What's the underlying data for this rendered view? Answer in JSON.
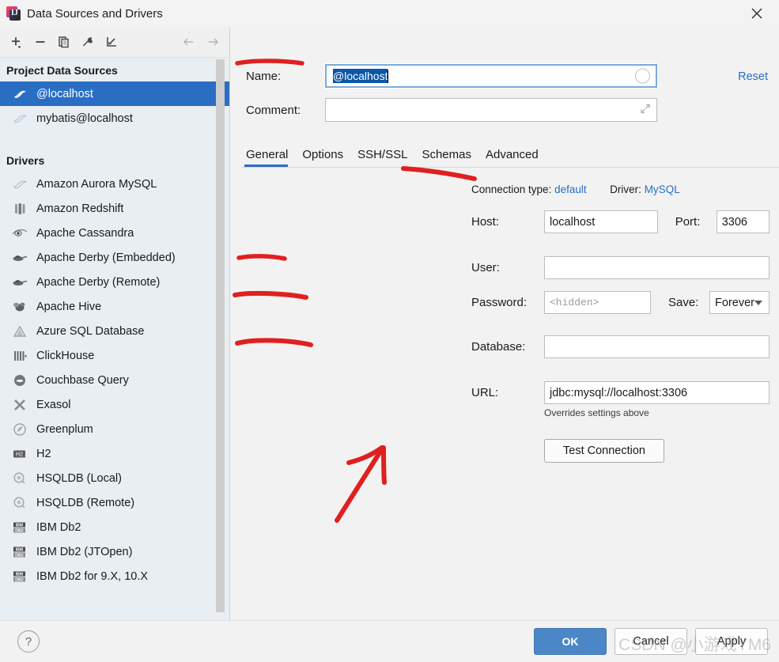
{
  "window": {
    "title": "Data Sources and Drivers",
    "app_icon": "intellij-idea-icon",
    "close_icon": "close-icon"
  },
  "left_panel": {
    "toolbar": [
      {
        "name": "add-button",
        "icon": "plus-icon"
      },
      {
        "name": "remove-button",
        "icon": "minus-icon"
      },
      {
        "name": "copy-button",
        "icon": "copy-icon"
      },
      {
        "name": "properties-button",
        "icon": "wrench-icon"
      },
      {
        "name": "import-button",
        "icon": "import-arrow-icon"
      },
      {
        "name": "back-button",
        "icon": "arrow-left-icon"
      },
      {
        "name": "forward-button",
        "icon": "arrow-right-icon"
      }
    ],
    "project_group_label": "Project Data Sources",
    "data_sources": [
      {
        "label": "@localhost",
        "icon": "mysql-dolphin-icon",
        "selected": true
      },
      {
        "label": "mybatis@localhost",
        "icon": "mysql-dolphin-icon",
        "selected": false
      }
    ],
    "drivers_group_label": "Drivers",
    "drivers": [
      {
        "label": "Amazon Aurora MySQL",
        "icon": "mysql-dolphin-icon"
      },
      {
        "label": "Amazon Redshift",
        "icon": "redshift-icon"
      },
      {
        "label": "Apache Cassandra",
        "icon": "cassandra-eye-icon"
      },
      {
        "label": "Apache Derby (Embedded)",
        "icon": "derby-hat-icon"
      },
      {
        "label": "Apache Derby (Remote)",
        "icon": "derby-hat-icon"
      },
      {
        "label": "Apache Hive",
        "icon": "hive-bee-icon"
      },
      {
        "label": "Azure SQL Database",
        "icon": "azure-triangle-icon"
      },
      {
        "label": "ClickHouse",
        "icon": "clickhouse-bars-icon"
      },
      {
        "label": "Couchbase Query",
        "icon": "couchbase-icon"
      },
      {
        "label": "Exasol",
        "icon": "exasol-x-icon"
      },
      {
        "label": "Greenplum",
        "icon": "greenplum-circle-icon"
      },
      {
        "label": "H2",
        "icon": "h2-icon"
      },
      {
        "label": "HSQLDB (Local)",
        "icon": "hsqldb-icon"
      },
      {
        "label": "HSQLDB (Remote)",
        "icon": "hsqldb-icon"
      },
      {
        "label": "IBM Db2",
        "icon": "ibm-db2-icon"
      },
      {
        "label": "IBM Db2 (JTOpen)",
        "icon": "ibm-db2-icon"
      },
      {
        "label": "IBM Db2 for 9.X, 10.X",
        "icon": "ibm-db2-icon"
      }
    ]
  },
  "detail": {
    "name_label": "Name:",
    "name_value": "@localhost",
    "comment_label": "Comment:",
    "comment_value": "",
    "reset_label": "Reset",
    "tabs": [
      {
        "label": "General",
        "active": true
      },
      {
        "label": "Options",
        "active": false
      },
      {
        "label": "SSH/SSL",
        "active": false
      },
      {
        "label": "Schemas",
        "active": false
      },
      {
        "label": "Advanced",
        "active": false
      }
    ],
    "connection_type_label": "Connection type:",
    "connection_type_value": "default",
    "driver_label": "Driver:",
    "driver_value": "MySQL",
    "host_label": "Host:",
    "host_value": "localhost",
    "port_label": "Port:",
    "port_value": "3306",
    "user_label": "User:",
    "user_value": "",
    "password_label": "Password:",
    "password_placeholder": "<hidden>",
    "save_label": "Save:",
    "save_value": "Forever",
    "database_label": "Database:",
    "database_value": "",
    "url_label": "URL:",
    "url_value": "jdbc:mysql://localhost:3306",
    "overrides_note": "Overrides settings above",
    "test_connection_label": "Test Connection"
  },
  "footer": {
    "help_icon": "question-mark-icon",
    "ok_label": "OK",
    "cancel_label": "Cancel",
    "apply_label": "Apply"
  },
  "watermark": {
    "text": "CSDN @小游戏YM6"
  },
  "colors": {
    "accent_blue": "#2a6ec4",
    "selection_blue": "#0a56a8",
    "primary_button": "#4b87c7",
    "annotation_red": "#e02020",
    "panel_bg": "#f2f2f2",
    "tree_bg": "#e9eef2"
  },
  "annotations": {
    "underlines": [
      "name",
      "driver",
      "user",
      "password",
      "database"
    ],
    "arrow_target": "test-connection-button"
  }
}
